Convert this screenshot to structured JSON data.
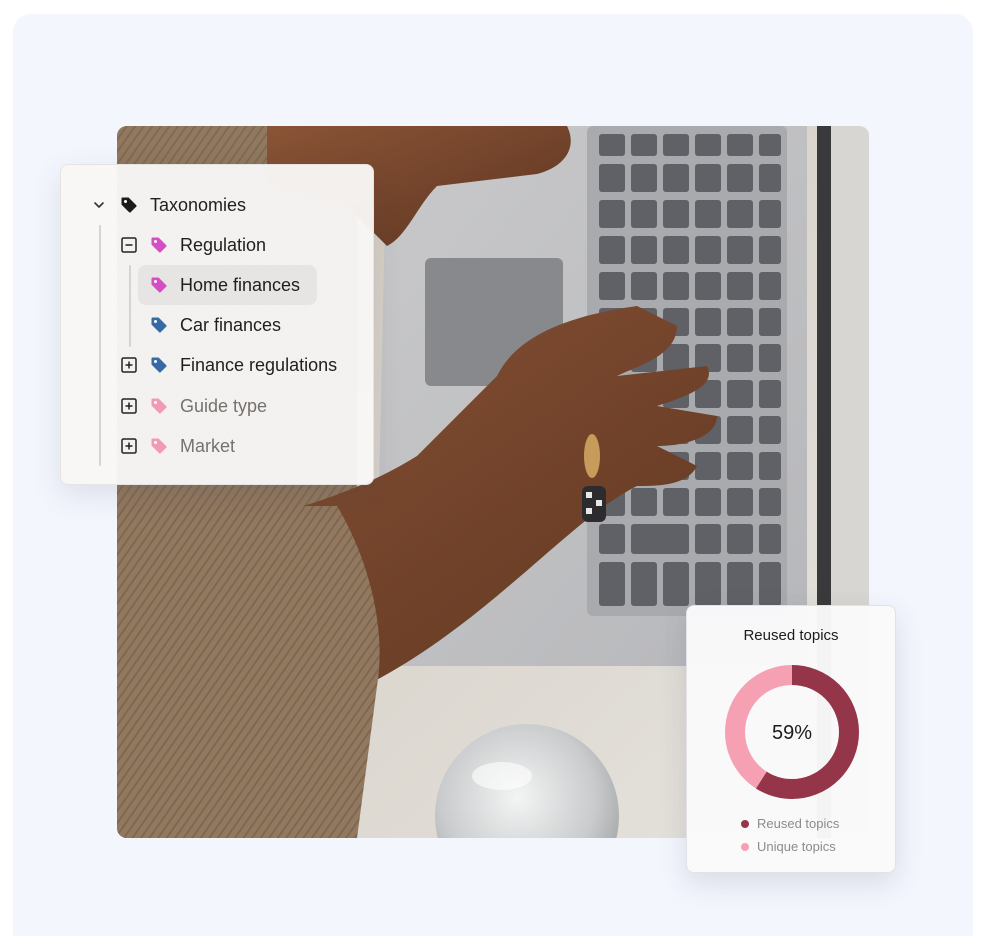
{
  "tree": {
    "root": {
      "label": "Taxonomies",
      "icon": "tag-icon",
      "color": "#1b1b1b"
    },
    "items": [
      {
        "label": "Regulation",
        "icon": "tag-icon",
        "color": "#d34fc3",
        "state": "expanded"
      },
      {
        "label": "Home finances",
        "icon": "tag-icon",
        "color": "#d34fc3",
        "selected": true
      },
      {
        "label": "Car finances",
        "icon": "tag-icon",
        "color": "#356aa4"
      },
      {
        "label": "Finance regulations",
        "icon": "tag-icon",
        "color": "#356aa4",
        "state": "collapsed"
      },
      {
        "label": "Guide type",
        "icon": "tag-icon",
        "color": "#f19ab4",
        "state": "collapsed"
      },
      {
        "label": "Market",
        "icon": "tag-icon",
        "color": "#f19ab4",
        "state": "collapsed"
      }
    ]
  },
  "donut": {
    "title": "Reused topics",
    "value_label": "59%",
    "legend": [
      {
        "label": "Reused topics",
        "color": "#953549"
      },
      {
        "label": "Unique topics",
        "color": "#f6a1b3"
      }
    ]
  },
  "chart_data": {
    "type": "pie",
    "title": "Reused topics",
    "categories": [
      "Reused topics",
      "Unique topics"
    ],
    "values": [
      59,
      41
    ],
    "unit": "%",
    "colors": [
      "#953549",
      "#f6a1b3"
    ],
    "legend": "bottom"
  },
  "photo": {
    "description_icon": "laptop-photo"
  }
}
